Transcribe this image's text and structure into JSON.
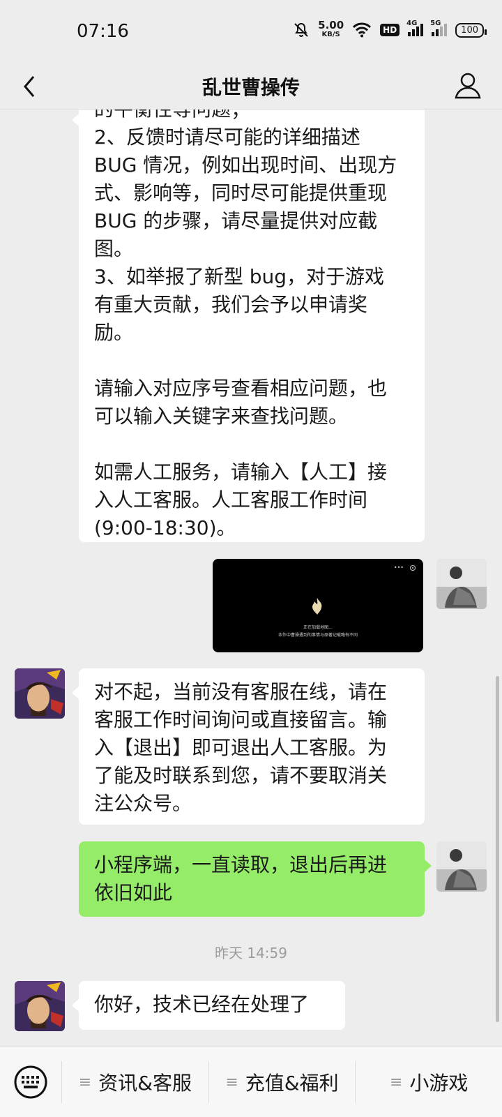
{
  "status_bar": {
    "time": "07:16",
    "net_speed_value": "5.00",
    "net_speed_unit": "KB/S",
    "hd_label": "HD",
    "sig1_label": "4G",
    "sig2_label": "5G",
    "battery": "100"
  },
  "header": {
    "title": "乱世曹操传"
  },
  "messages": [
    {
      "lines": [
        "的平衡性等问题；",
        "2、反馈时请尽可能的详细描述",
        "BUG 情况，例如出现时间、出现方",
        "式、影响等，同时尽可能提供重现",
        "BUG 的步骤，请尽量提供对应截",
        "图。",
        "3、如举报了新型 bug，对于游戏",
        "有重大贡献，我们会予以申请奖",
        "励。",
        "",
        "请输入对应序号查看相应问题，也",
        "可以输入关键字来查找问题。",
        "",
        "如需人工服务，请输入【人工】接",
        "入人工客服。人工客服工作时间",
        "(9:00-18:30)。"
      ]
    },
    {
      "video_caption_top": "正在加载地图...",
      "video_caption_bottom": "本作中曹操遇到的事情与原著记载略有不同"
    },
    {
      "lines": [
        "对不起，当前没有客服在线，请在",
        "客服工作时间询问或直接留言。输",
        "入【退出】即可退出人工客服。为",
        "了能及时联系到您，请不要取消关",
        "注公众号。"
      ]
    },
    {
      "lines": [
        "小程序端，一直读取，退出后再进",
        "依旧如此"
      ]
    },
    {
      "timestamp": "昨天 14:59"
    },
    {
      "lines": [
        "你好，技术已经在处理了"
      ]
    }
  ],
  "bottom_menu": {
    "items": [
      "资讯&客服",
      "充值&福利",
      "小游戏"
    ]
  }
}
